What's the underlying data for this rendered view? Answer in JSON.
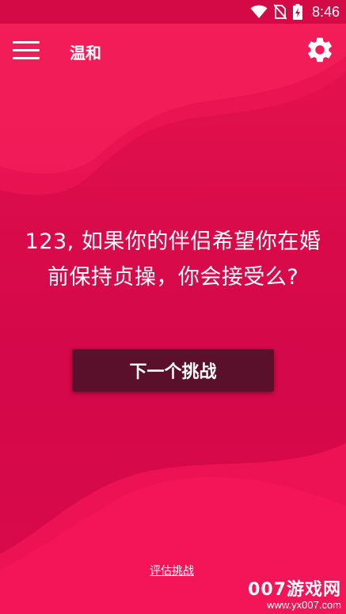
{
  "status_bar": {
    "time": "8:46",
    "icons": [
      "wifi-icon",
      "no-sim-icon",
      "battery-charging-icon"
    ]
  },
  "app_bar": {
    "title": "温和",
    "menu_icon": "hamburger-menu-icon",
    "settings_icon": "gear-icon"
  },
  "question": {
    "text": "123, 如果你的伴侣希望你在婚前保持贞操，你会接受么?"
  },
  "actions": {
    "next_label": "下一个挑战",
    "rate_label": "评估挑战"
  },
  "watermark": {
    "line1": "007游戏网",
    "line2": "www.yx007.com"
  },
  "colors": {
    "background": "#d80a4a",
    "status_bar": "#d40a47",
    "button": "#5a0f2a",
    "accent_wave": "#ff1a5c"
  }
}
